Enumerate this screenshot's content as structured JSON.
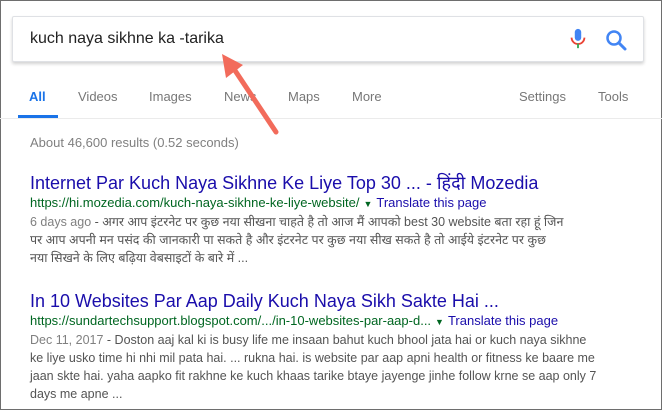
{
  "search": {
    "query": "kuch naya sikhne ka -tarika"
  },
  "icons": {
    "mic": "mic-icon",
    "search": "search-icon"
  },
  "colors": {
    "link": "#1a0dab",
    "url": "#006621",
    "accent": "#1a73e8",
    "arrow": "#f26b5b"
  },
  "tabs": {
    "items": [
      {
        "label": "All"
      },
      {
        "label": "Videos"
      },
      {
        "label": "Images"
      },
      {
        "label": "News"
      },
      {
        "label": "Maps"
      },
      {
        "label": "More"
      },
      {
        "label": "Settings"
      },
      {
        "label": "Tools"
      }
    ]
  },
  "stats": "About 46,600 results (0.52 seconds)",
  "results": [
    {
      "title": "Internet Par Kuch Naya Sikhne Ke Liye Top 30 ... - हिंदी Mozedia",
      "url": "https://hi.mozedia.com/kuch-naya-sikhne-ke-liye-website/",
      "translate": "Translate this page",
      "date": "6 days ago",
      "snippet_line1": " - अगर आप इंटरनेट पर कुछ नया सीखना चाहते है तो आज मैं आपको best 30 website बता रहा हूं जिन",
      "snippet_line2": "पर आप अपनी मन पसंद की जानकारी पा सकते है और इंटरनेट पर कुछ नया सीख सकते है तो आईये इंटरनेट पर कुछ",
      "snippet_line3": "नया सिखने के लिए बढ़िया वेबसाइटों के बारे में ..."
    },
    {
      "title": "In 10 Websites Par Aap Daily Kuch Naya Sikh Sakte Hai ...",
      "url": "https://sundartechsupport.blogspot.com/.../in-10-websites-par-aap-d...",
      "translate": "Translate this page",
      "date": "Dec 11, 2017",
      "snippet_line1": " - Doston aaj kal ki is busy life me insaan bahut kuch bhool jata hai or kuch naya sikhne",
      "snippet_line2": "ke liye usko time hi nhi mil pata hai. ... rukna hai. is website par aap apni health or fitness ke baare me",
      "snippet_line3": "jaan skte hai. yaha aapko fit rakhne ke kuch khaas tarike btaye jayenge jinhe follow krne se aap only 7",
      "snippet_line4": "days me apne ..."
    }
  ]
}
